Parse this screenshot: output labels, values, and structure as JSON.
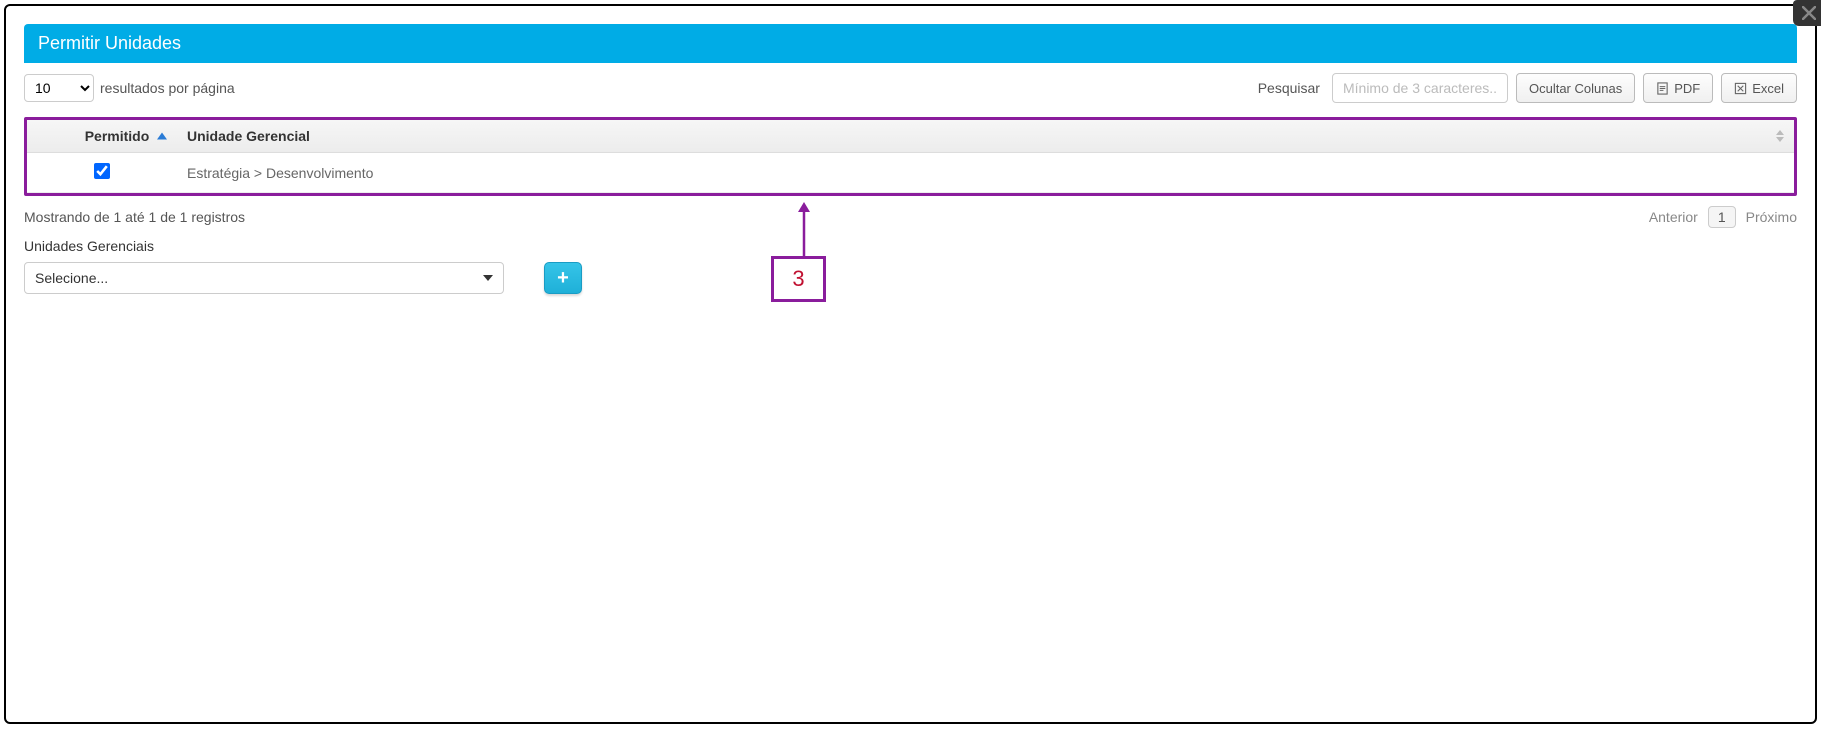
{
  "panel": {
    "title": "Permitir Unidades"
  },
  "pageSize": {
    "value": "10",
    "label": "resultados por página"
  },
  "search": {
    "label": "Pesquisar",
    "placeholder": "Mínimo de 3 caracteres..."
  },
  "buttons": {
    "hideColumns": "Ocultar Colunas",
    "pdf": "PDF",
    "excel": "Excel"
  },
  "table": {
    "headers": {
      "permitido": "Permitido",
      "unidade": "Unidade Gerencial"
    },
    "rows": [
      {
        "checked": true,
        "unidade": "Estratégia > Desenvolvimento"
      }
    ]
  },
  "info": "Mostrando de 1 até 1 de 1 registros",
  "pagination": {
    "prev": "Anterior",
    "page": "1",
    "next": "Próximo"
  },
  "sectionLabel": "Unidades Gerenciais",
  "dropdown": {
    "placeholder": "Selecione..."
  },
  "annotation": {
    "number": "3"
  }
}
